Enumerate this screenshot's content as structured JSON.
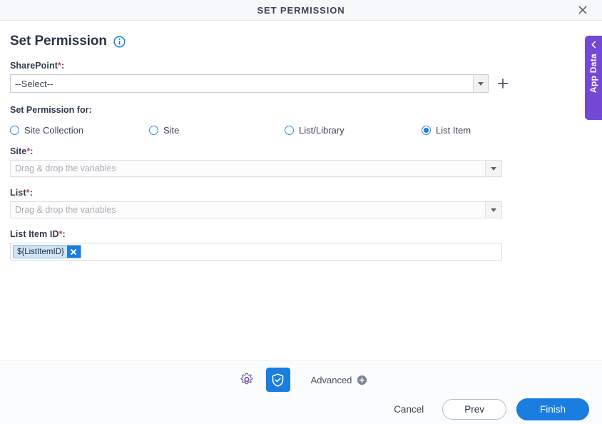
{
  "window": {
    "title": "SET PERMISSION",
    "close_icon": "close-icon"
  },
  "page": {
    "heading": "Set Permission",
    "info_icon": "info-icon"
  },
  "form": {
    "sharepoint": {
      "label": "SharePoint",
      "required_marker": "*",
      "colon": ":",
      "selected_value": "--Select--",
      "dropdown_icon": "chevron-down-icon",
      "add_icon": "plus-icon"
    },
    "permission_for": {
      "label": "Set Permission for:",
      "options": [
        {
          "label": "Site Collection",
          "selected": false
        },
        {
          "label": "Site",
          "selected": false
        },
        {
          "label": "List/Library",
          "selected": false
        },
        {
          "label": "List Item",
          "selected": true
        }
      ]
    },
    "site": {
      "label": "Site",
      "required_marker": "*",
      "colon": ":",
      "placeholder": "Drag & drop the variables",
      "value": "",
      "dropdown_icon": "chevron-down-icon"
    },
    "list": {
      "label": "List",
      "required_marker": "*",
      "colon": ":",
      "placeholder": "Drag & drop the variables",
      "value": "",
      "dropdown_icon": "chevron-down-icon"
    },
    "list_item_id": {
      "label": "List Item ID",
      "required_marker": "*",
      "colon": ":",
      "token": "${ListItemID}",
      "remove_icon": "close-icon"
    }
  },
  "footer": {
    "settings_icon": "gear-icon",
    "security_icon": "shield-check-icon",
    "advanced_label": "Advanced",
    "advanced_icon": "plus-circle-icon",
    "cancel_label": "Cancel",
    "prev_label": "Prev",
    "finish_label": "Finish"
  },
  "app_data_panel": {
    "label": "App Data",
    "toggle_icon": "chevron-left-icon"
  },
  "colors": {
    "accent_blue": "#1a7de0",
    "purple": "#7348d4",
    "required_red": "#d0434f",
    "title_text": "#3b4559"
  }
}
